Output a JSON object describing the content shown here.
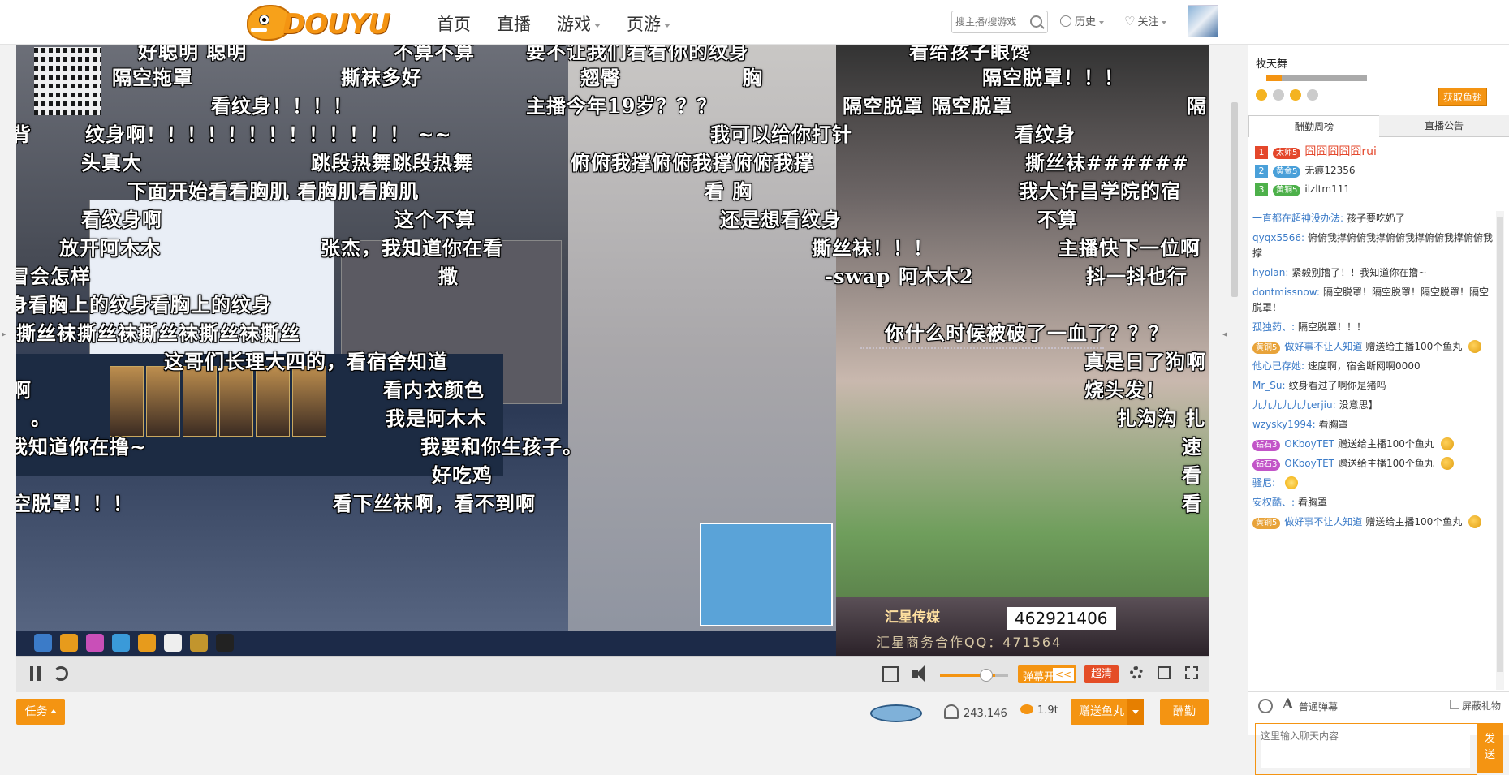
{
  "header": {
    "logo_text": "DOUYU",
    "nav": [
      {
        "label": "首页",
        "dropdown": false
      },
      {
        "label": "直播",
        "dropdown": false
      },
      {
        "label": "游戏",
        "dropdown": true
      },
      {
        "label": "页游",
        "dropdown": true
      }
    ],
    "search_placeholder": "搜主播/搜游戏",
    "history_label": "历史",
    "follow_label": "关注"
  },
  "video": {
    "barrage": [
      "好聪明 聪明",
      "不算不算",
      "要不让我们看看你的纹身",
      "看给孩子眼馋",
      "隔空拖罩",
      "撕袜多好",
      "翘臀",
      "胸",
      "隔空脱罩！！！",
      "看纹身！！！！",
      "主播今年19岁？？？",
      "隔空脱罩 隔空脱罩",
      "隔",
      "背",
      "纹身啊！！！！！！！！！！！！！ ~~",
      "我可以给你打针",
      "看纹身",
      "头真大",
      "跳段热舞跳段热舞",
      "俯俯我撑俯俯我撑俯俯我撑",
      "撕丝袜######",
      "下面开始看看胸肌 看胸肌看胸肌",
      "看 胸",
      "我大许昌学院的宿",
      "看纹身啊",
      "这个不算",
      "还是想看纹身",
      "不算",
      "放开阿木木",
      "张杰，我知道你在看",
      "撕丝袜！！！",
      "主播快下一位啊",
      "冒会怎样",
      "撒",
      "-swap  阿木木2",
      "抖一抖也行",
      "身看胸上的纹身看胸上的纹身",
      "撕丝袜撕丝袜撕丝袜撕丝袜撕丝",
      "你什么时候被破了一血了？？？",
      "这哥们长理大四的，看宿舍知道",
      "真是日了狗啊",
      "啊",
      "看内衣颜色",
      "烧头发！",
      "。",
      "我是阿木木",
      "扎沟沟  扎",
      "我知道你在撸~",
      "我要和你生孩子。",
      "速",
      "好吃鸡",
      "看",
      "空脱罩！！！",
      "看下丝袜啊，看不到啊",
      "看"
    ],
    "overlay_qq_number": "462921406",
    "overlay_company": "汇星传媒",
    "overlay_contact": "汇星商务合作QQ：471564"
  },
  "controls": {
    "danmu_label": "弹幕开",
    "danmu_switch": "<<",
    "quality_label": "超清",
    "volume_percent": 75
  },
  "bottom": {
    "task_label": "任务",
    "viewers": "243,146",
    "fish_weight": "1.9t",
    "give_label": "赠送鱼丸",
    "thanks_label": "酬勤"
  },
  "panel": {
    "host_name": "牧天舞",
    "level_percent": 15,
    "get_fish_label": "获取鱼翅",
    "tabs": [
      "酬勤周榜",
      "直播公告"
    ],
    "ranks": [
      {
        "rank": "1",
        "badge": "太师5",
        "name": "囧囧囧囧囧rui",
        "color": "#e4472b"
      },
      {
        "rank": "2",
        "badge": "黄金5",
        "name": "无痕12356",
        "color": "#4aa0d9"
      },
      {
        "rank": "3",
        "badge": "黄铜5",
        "name": "ilzltm111",
        "color": "#4db04a"
      }
    ],
    "messages": [
      {
        "name": "一直都在超神没办法:",
        "text": "孩子要吃奶了"
      },
      {
        "name": "qyqx5566:",
        "text": "俯俯我撑俯俯我撑俯俯我撑俯俯我撑俯俯我撑"
      },
      {
        "name": "hyolan:",
        "text": "紧毅别撸了！！我知道你在撸~"
      },
      {
        "name": "dontmissnow:",
        "text": "隔空脱罩！隔空脱罩！隔空脱罩！隔空脱罩！"
      },
      {
        "name": "孤独药、:",
        "text": "隔空脱罩！！！"
      },
      {
        "badge": "黄铜5",
        "name": "做好事不让人知道",
        "gift": "赠送给主播100个鱼丸"
      },
      {
        "name": "他心已存她:",
        "text": "速度啊，宿舍断网啊0000"
      },
      {
        "name": "Mr_Su:",
        "text": "纹身看过了啊你是猪吗"
      },
      {
        "name": "九九九九九九erjiu:",
        "text": "没意思】"
      },
      {
        "name": "wzysky1994:",
        "text": "看胸罩"
      },
      {
        "badge": "钻石3",
        "name": "OKboyTET",
        "gift": "赠送给主播100个鱼丸"
      },
      {
        "badge": "钻石3",
        "name": "OKboyTET",
        "gift": "赠送给主播100个鱼丸"
      },
      {
        "name": "骚尼:",
        "text": ""
      },
      {
        "name": "安权酷、:",
        "text": "看胸罩"
      },
      {
        "badge": "黄铜5",
        "name": "做好事不让人知道",
        "gift": "赠送给主播100个鱼丸"
      }
    ],
    "input_mode": "普通弹幕",
    "block_gift_label": "屏蔽礼物",
    "chat_placeholder": "这里输入聊天内容",
    "send_label": "发送"
  }
}
